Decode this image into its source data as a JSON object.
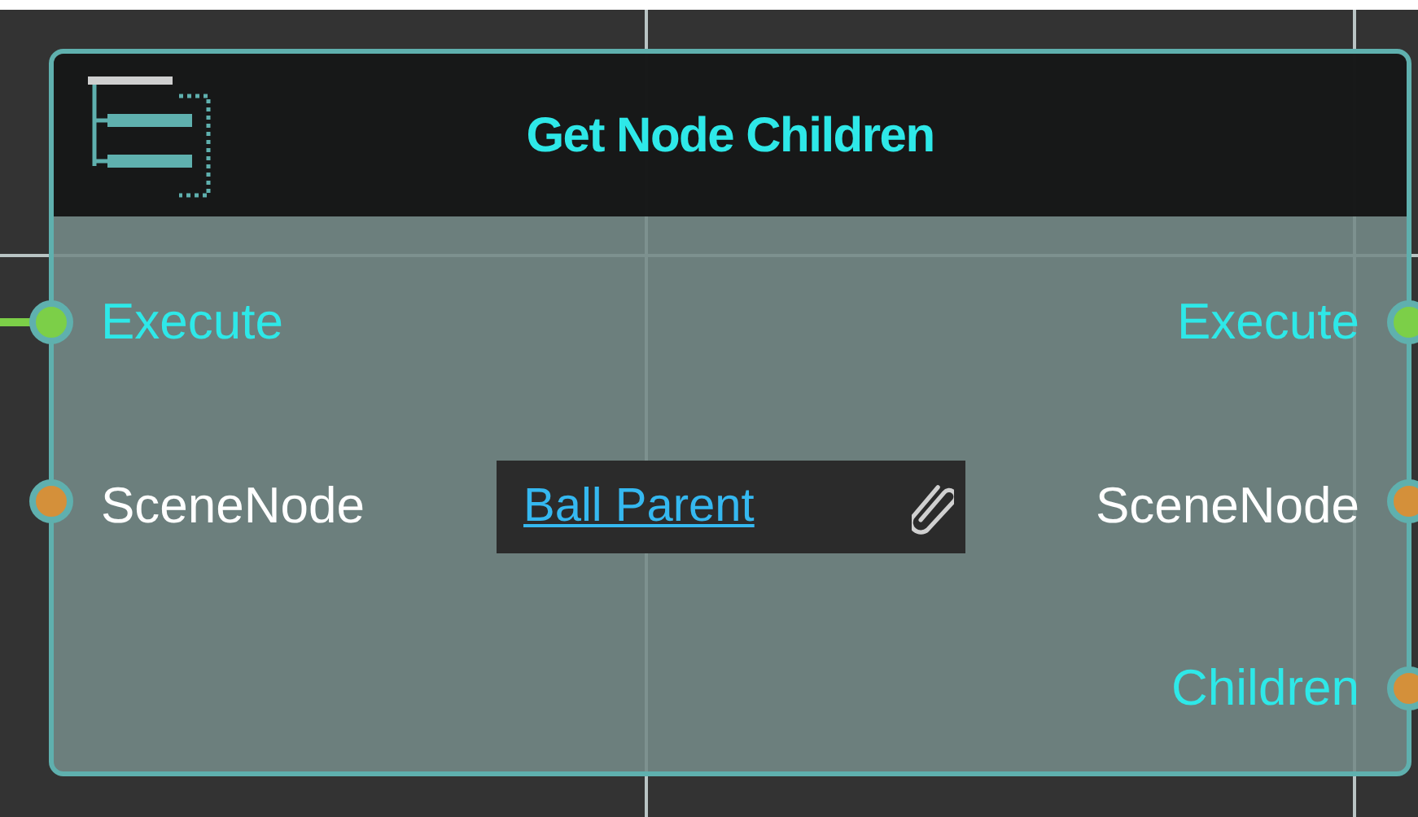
{
  "node": {
    "title": "Get Node Children",
    "inputs": [
      {
        "label": "Execute",
        "color": "#7ccf48",
        "highlighted": true,
        "connected": true
      },
      {
        "label": "SceneNode",
        "color": "#d4903a",
        "highlighted": false,
        "connected": false,
        "value": "Ball Parent"
      }
    ],
    "outputs": [
      {
        "label": "Execute",
        "color": "#7ccf48",
        "highlighted": true
      },
      {
        "label": "SceneNode",
        "color": "#d4903a",
        "highlighted": false
      },
      {
        "label": "Children",
        "color": "#d4903a",
        "highlighted": true
      }
    ]
  }
}
